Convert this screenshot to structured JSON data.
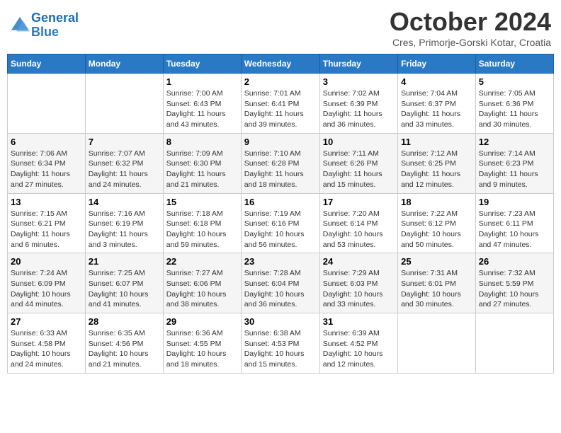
{
  "header": {
    "logo_line1": "General",
    "logo_line2": "Blue",
    "month_title": "October 2024",
    "location": "Cres, Primorje-Gorski Kotar, Croatia"
  },
  "days_of_week": [
    "Sunday",
    "Monday",
    "Tuesday",
    "Wednesday",
    "Thursday",
    "Friday",
    "Saturday"
  ],
  "weeks": [
    [
      {
        "day": "",
        "info": ""
      },
      {
        "day": "",
        "info": ""
      },
      {
        "day": "1",
        "info": "Sunrise: 7:00 AM\nSunset: 6:43 PM\nDaylight: 11 hours and 43 minutes."
      },
      {
        "day": "2",
        "info": "Sunrise: 7:01 AM\nSunset: 6:41 PM\nDaylight: 11 hours and 39 minutes."
      },
      {
        "day": "3",
        "info": "Sunrise: 7:02 AM\nSunset: 6:39 PM\nDaylight: 11 hours and 36 minutes."
      },
      {
        "day": "4",
        "info": "Sunrise: 7:04 AM\nSunset: 6:37 PM\nDaylight: 11 hours and 33 minutes."
      },
      {
        "day": "5",
        "info": "Sunrise: 7:05 AM\nSunset: 6:36 PM\nDaylight: 11 hours and 30 minutes."
      }
    ],
    [
      {
        "day": "6",
        "info": "Sunrise: 7:06 AM\nSunset: 6:34 PM\nDaylight: 11 hours and 27 minutes."
      },
      {
        "day": "7",
        "info": "Sunrise: 7:07 AM\nSunset: 6:32 PM\nDaylight: 11 hours and 24 minutes."
      },
      {
        "day": "8",
        "info": "Sunrise: 7:09 AM\nSunset: 6:30 PM\nDaylight: 11 hours and 21 minutes."
      },
      {
        "day": "9",
        "info": "Sunrise: 7:10 AM\nSunset: 6:28 PM\nDaylight: 11 hours and 18 minutes."
      },
      {
        "day": "10",
        "info": "Sunrise: 7:11 AM\nSunset: 6:26 PM\nDaylight: 11 hours and 15 minutes."
      },
      {
        "day": "11",
        "info": "Sunrise: 7:12 AM\nSunset: 6:25 PM\nDaylight: 11 hours and 12 minutes."
      },
      {
        "day": "12",
        "info": "Sunrise: 7:14 AM\nSunset: 6:23 PM\nDaylight: 11 hours and 9 minutes."
      }
    ],
    [
      {
        "day": "13",
        "info": "Sunrise: 7:15 AM\nSunset: 6:21 PM\nDaylight: 11 hours and 6 minutes."
      },
      {
        "day": "14",
        "info": "Sunrise: 7:16 AM\nSunset: 6:19 PM\nDaylight: 11 hours and 3 minutes."
      },
      {
        "day": "15",
        "info": "Sunrise: 7:18 AM\nSunset: 6:18 PM\nDaylight: 10 hours and 59 minutes."
      },
      {
        "day": "16",
        "info": "Sunrise: 7:19 AM\nSunset: 6:16 PM\nDaylight: 10 hours and 56 minutes."
      },
      {
        "day": "17",
        "info": "Sunrise: 7:20 AM\nSunset: 6:14 PM\nDaylight: 10 hours and 53 minutes."
      },
      {
        "day": "18",
        "info": "Sunrise: 7:22 AM\nSunset: 6:12 PM\nDaylight: 10 hours and 50 minutes."
      },
      {
        "day": "19",
        "info": "Sunrise: 7:23 AM\nSunset: 6:11 PM\nDaylight: 10 hours and 47 minutes."
      }
    ],
    [
      {
        "day": "20",
        "info": "Sunrise: 7:24 AM\nSunset: 6:09 PM\nDaylight: 10 hours and 44 minutes."
      },
      {
        "day": "21",
        "info": "Sunrise: 7:25 AM\nSunset: 6:07 PM\nDaylight: 10 hours and 41 minutes."
      },
      {
        "day": "22",
        "info": "Sunrise: 7:27 AM\nSunset: 6:06 PM\nDaylight: 10 hours and 38 minutes."
      },
      {
        "day": "23",
        "info": "Sunrise: 7:28 AM\nSunset: 6:04 PM\nDaylight: 10 hours and 36 minutes."
      },
      {
        "day": "24",
        "info": "Sunrise: 7:29 AM\nSunset: 6:03 PM\nDaylight: 10 hours and 33 minutes."
      },
      {
        "day": "25",
        "info": "Sunrise: 7:31 AM\nSunset: 6:01 PM\nDaylight: 10 hours and 30 minutes."
      },
      {
        "day": "26",
        "info": "Sunrise: 7:32 AM\nSunset: 5:59 PM\nDaylight: 10 hours and 27 minutes."
      }
    ],
    [
      {
        "day": "27",
        "info": "Sunrise: 6:33 AM\nSunset: 4:58 PM\nDaylight: 10 hours and 24 minutes."
      },
      {
        "day": "28",
        "info": "Sunrise: 6:35 AM\nSunset: 4:56 PM\nDaylight: 10 hours and 21 minutes."
      },
      {
        "day": "29",
        "info": "Sunrise: 6:36 AM\nSunset: 4:55 PM\nDaylight: 10 hours and 18 minutes."
      },
      {
        "day": "30",
        "info": "Sunrise: 6:38 AM\nSunset: 4:53 PM\nDaylight: 10 hours and 15 minutes."
      },
      {
        "day": "31",
        "info": "Sunrise: 6:39 AM\nSunset: 4:52 PM\nDaylight: 10 hours and 12 minutes."
      },
      {
        "day": "",
        "info": ""
      },
      {
        "day": "",
        "info": ""
      }
    ]
  ]
}
